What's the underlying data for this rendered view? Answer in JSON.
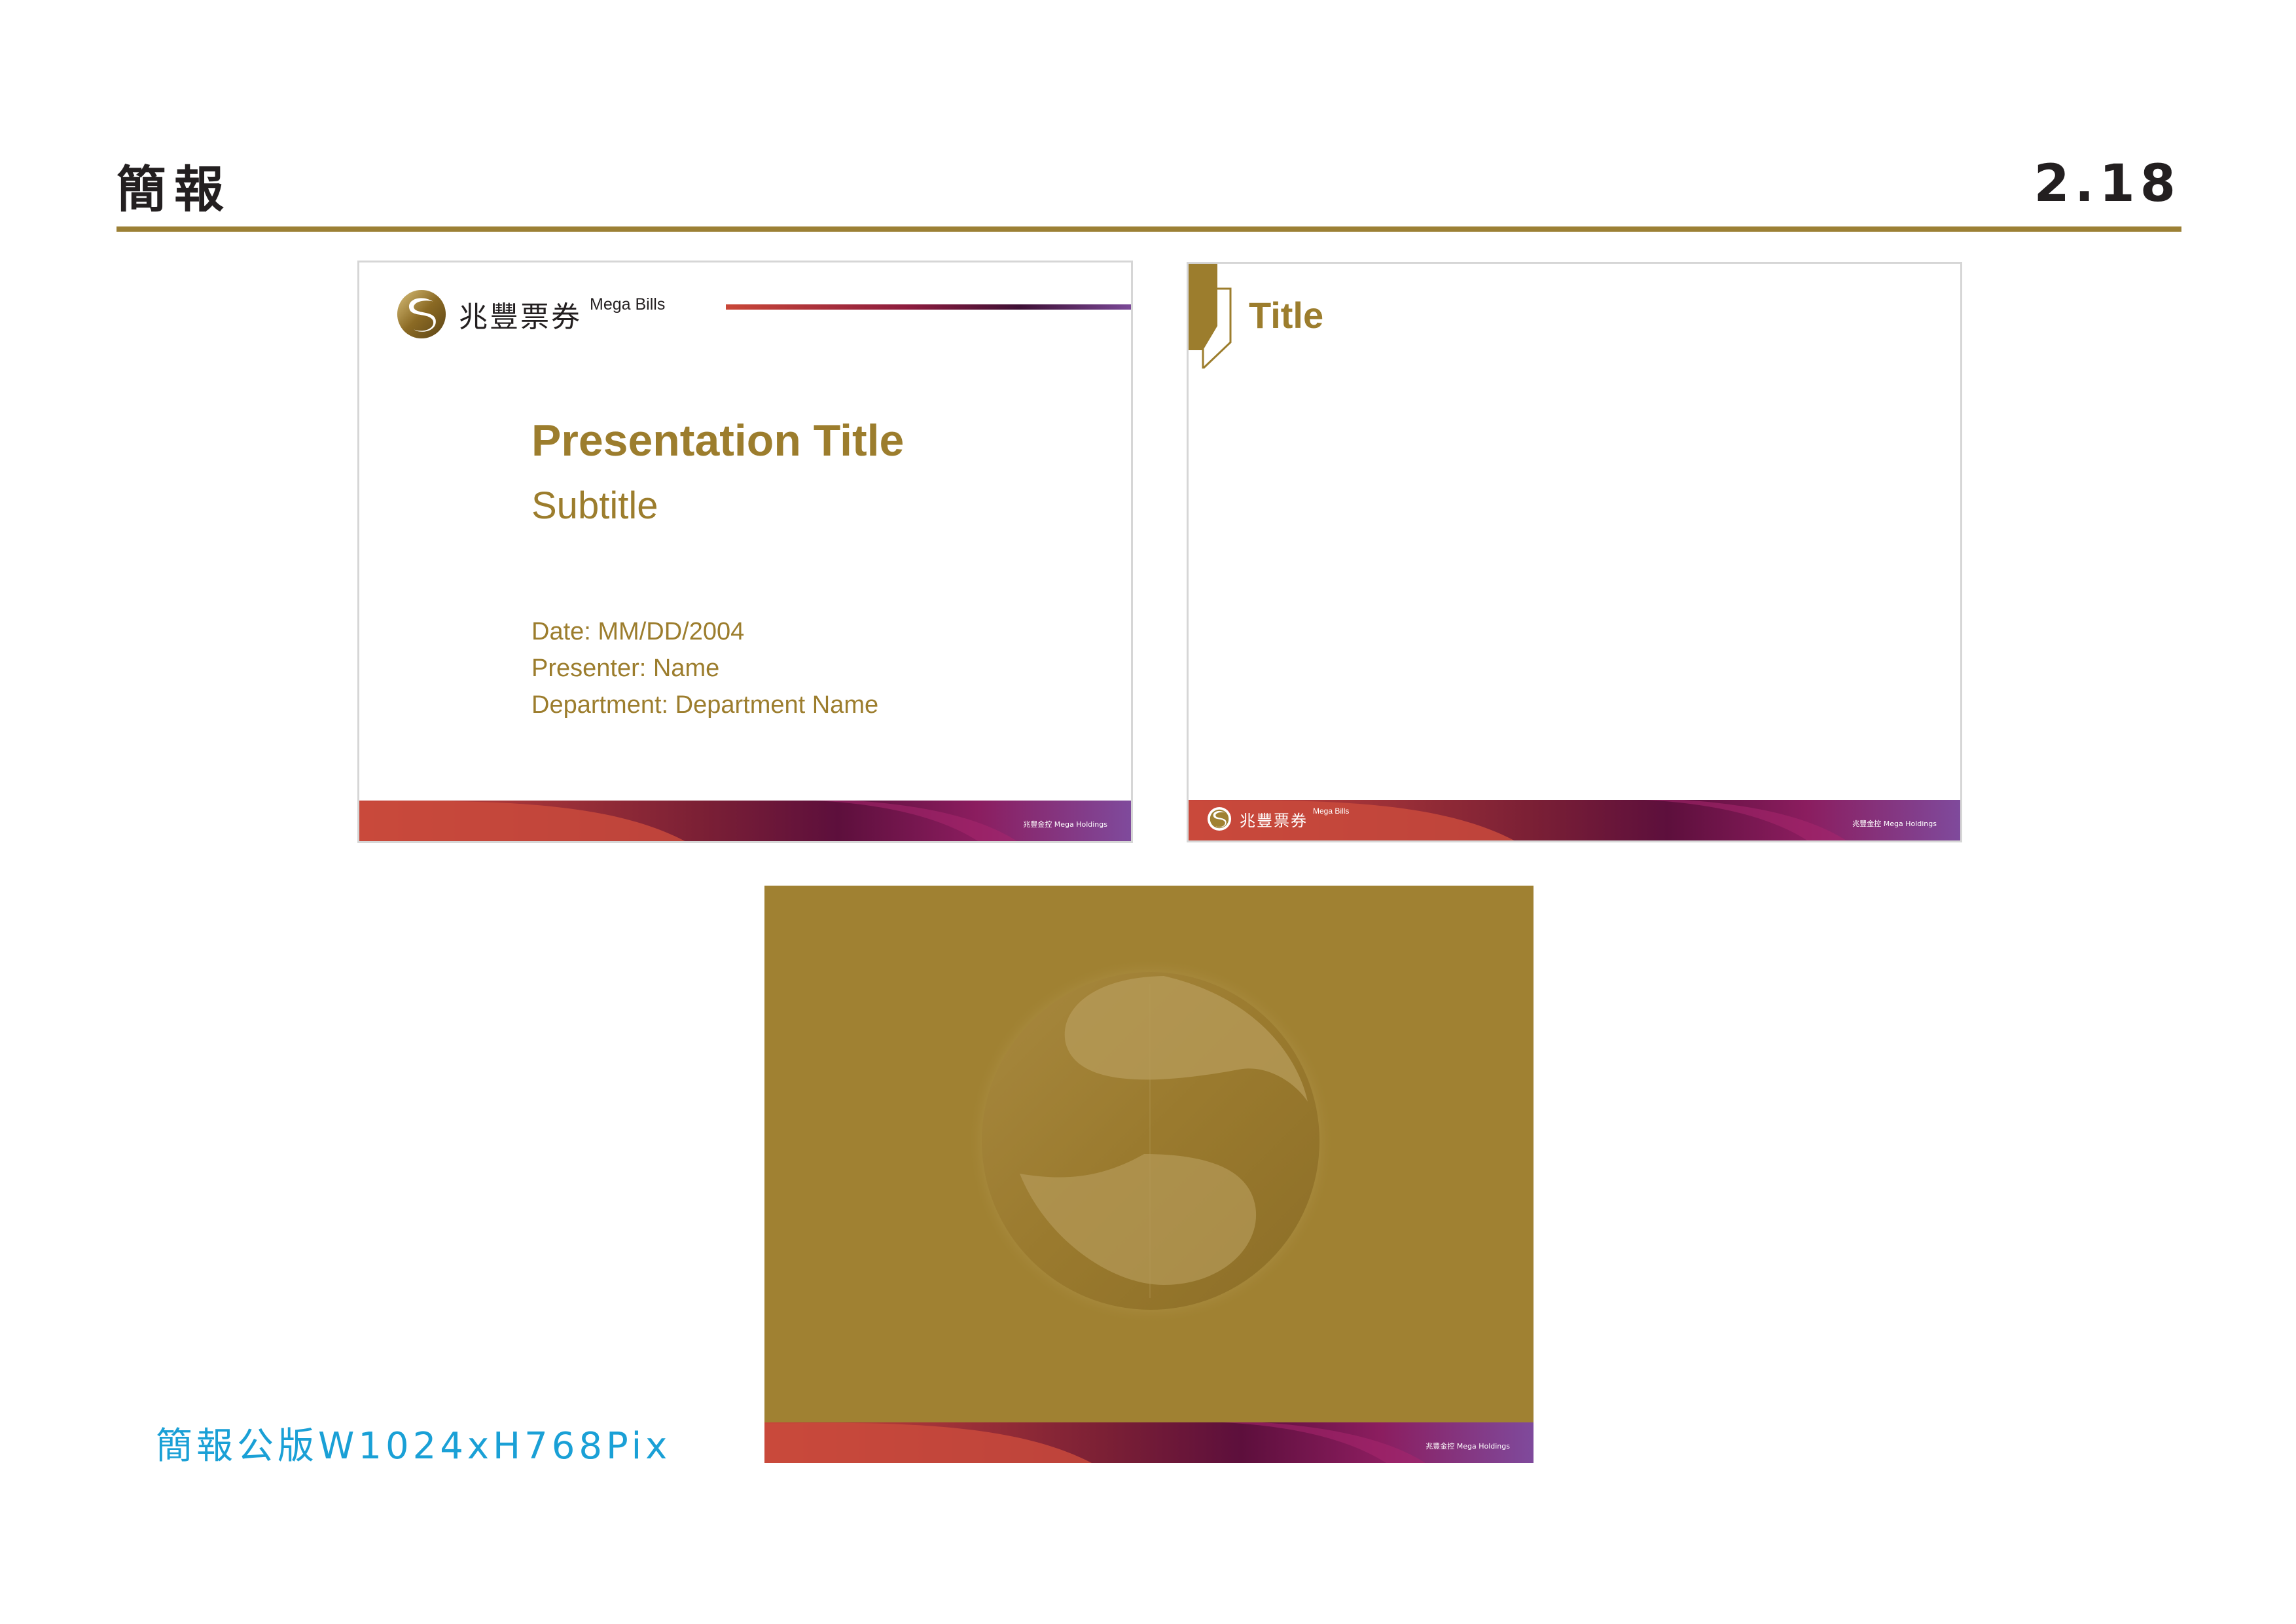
{
  "header": {
    "title": "簡報",
    "page_number": "2.18"
  },
  "brand": {
    "name_zh": "兆豐票券",
    "name_en": "Mega Bills",
    "holdings": "兆豐金控   Mega Holdings",
    "colors": {
      "gold": "#9c7d2d",
      "gold_background": "#a08132",
      "red": "#c94738",
      "magenta": "#8c1c4e",
      "purple": "#7d4b9b",
      "rule": "#9c8035"
    }
  },
  "cover_slide": {
    "title": "Presentation Title",
    "subtitle": "Subtitle",
    "date": "Date: MM/DD/2004",
    "presenter": "Presenter: Name",
    "department": "Department: Department Name"
  },
  "content_slide": {
    "title": "Title"
  },
  "caption": "簡報公版W1024xH768Pix"
}
